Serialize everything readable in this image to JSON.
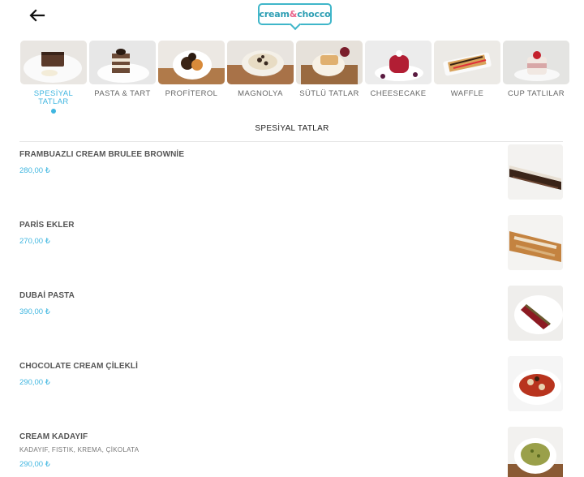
{
  "header": {
    "logo": {
      "part1": "cream",
      "part2": "&",
      "part3": "chocco"
    },
    "back_icon": "arrow-left-icon"
  },
  "categories": [
    {
      "label": "SPESİYAL TATLAR",
      "active": true
    },
    {
      "label": "PASTA & TART",
      "active": false
    },
    {
      "label": "PROFİTEROL",
      "active": false
    },
    {
      "label": "MAGNOLYA",
      "active": false
    },
    {
      "label": "SÜTLÜ TATLAR",
      "active": false
    },
    {
      "label": "CHEESECAKE",
      "active": false
    },
    {
      "label": "WAFFLE",
      "active": false
    },
    {
      "label": "CUP TATLILAR",
      "active": false
    }
  ],
  "section_title": "SPESİYAL TATLAR",
  "items": [
    {
      "name": "FRAMBUAZLI CREAM BRULEE BROWNİE",
      "price": "280,00 ₺"
    },
    {
      "name": "PARİS EKLER",
      "price": "270,00 ₺"
    },
    {
      "name": "DUBAİ PASTA",
      "price": "390,00 ₺"
    },
    {
      "name": "CHOCOLATE CREAM ÇİLEKLİ",
      "price": "290,00 ₺"
    },
    {
      "name": "CREAM KADAYIF",
      "description": "KADAYIF, FISTIK, KREMA, ÇİKOLATA",
      "price": "290,00 ₺"
    }
  ],
  "colors": {
    "accent": "#3fb6e0",
    "logo_border": "#3fb6c9",
    "logo_pink": "#e8638a"
  }
}
